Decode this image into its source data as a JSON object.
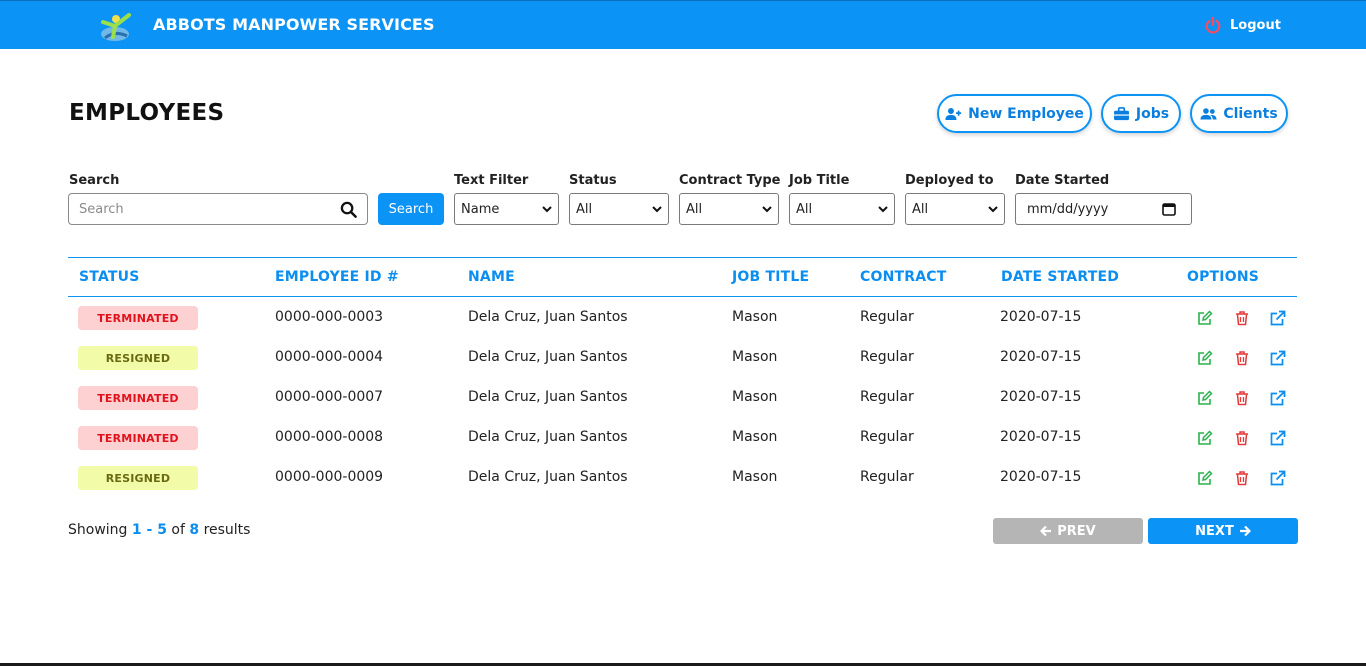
{
  "app": {
    "brand": "ABBOTS MANPOWER SERVICES",
    "logout_label": "Logout"
  },
  "page": {
    "title": "EMPLOYEES"
  },
  "actions": {
    "new_employee": "New Employee",
    "jobs": "Jobs",
    "clients": "Clients"
  },
  "filters": {
    "search_label": "Search",
    "search_placeholder": "Search",
    "search_button": "Search",
    "text_filter_label": "Text Filter",
    "text_filter_value": "Name",
    "status_label": "Status",
    "status_value": "All",
    "contract_type_label": "Contract Type",
    "contract_type_value": "All",
    "job_title_label": "Job Title",
    "job_title_value": "All",
    "deployed_to_label": "Deployed to",
    "deployed_to_value": "All",
    "date_started_label": "Date Started",
    "date_started_value": "mm/dd/yyyy"
  },
  "table": {
    "columns": [
      "STATUS",
      "EMPLOYEE ID #",
      "NAME",
      "JOB TITLE",
      "CONTRACT",
      "DATE STARTED",
      "OPTIONS"
    ],
    "rows": [
      {
        "status": "TERMINATED",
        "employee_id": "0000-000-0003",
        "name": "Dela Cruz, Juan Santos",
        "job_title": "Mason",
        "contract": "Regular",
        "date_started": "2020-07-15"
      },
      {
        "status": "RESIGNED",
        "employee_id": "0000-000-0004",
        "name": "Dela Cruz, Juan Santos",
        "job_title": "Mason",
        "contract": "Regular",
        "date_started": "2020-07-15"
      },
      {
        "status": "TERMINATED",
        "employee_id": "0000-000-0007",
        "name": "Dela Cruz, Juan Santos",
        "job_title": "Mason",
        "contract": "Regular",
        "date_started": "2020-07-15"
      },
      {
        "status": "TERMINATED",
        "employee_id": "0000-000-0008",
        "name": "Dela Cruz, Juan Santos",
        "job_title": "Mason",
        "contract": "Regular",
        "date_started": "2020-07-15"
      },
      {
        "status": "RESIGNED",
        "employee_id": "0000-000-0009",
        "name": "Dela Cruz, Juan Santos",
        "job_title": "Mason",
        "contract": "Regular",
        "date_started": "2020-07-15"
      }
    ],
    "row_icons": [
      "edit-icon",
      "trash-icon",
      "external-link-icon"
    ]
  },
  "pagination": {
    "showing_prefix": "Showing",
    "range_start": "1",
    "range_sep": " - ",
    "range_end": "5",
    "of_text": "of",
    "total": "8",
    "results_text": "results",
    "prev_label": "PREV",
    "next_label": "NEXT"
  },
  "colors": {
    "accent": "#0b93f5",
    "terminated_bg": "#fdd0d2",
    "terminated_text": "#e2121d",
    "resigned_bg": "#f2fba8",
    "resigned_text": "#6b6a12",
    "edit": "#2bb24c",
    "delete": "#e5393a",
    "open": "#0b8ef0"
  }
}
